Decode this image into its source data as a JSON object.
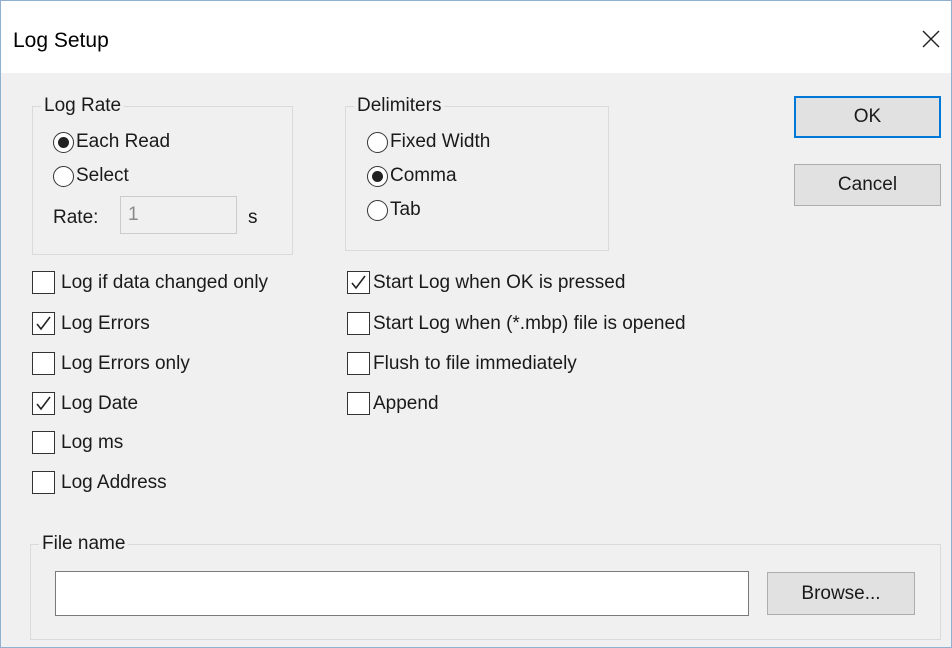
{
  "window": {
    "title": "Log Setup",
    "close_glyph": "✕"
  },
  "log_rate": {
    "label": "Log Rate",
    "options": [
      {
        "label": "Each Read",
        "selected": true
      },
      {
        "label": "Select",
        "selected": false
      }
    ],
    "rate_label": "Rate:",
    "rate_value": "1",
    "rate_unit": "s"
  },
  "delimiters": {
    "label": "Delimiters",
    "options": [
      {
        "label": "Fixed Width",
        "selected": false
      },
      {
        "label": "Comma",
        "selected": true
      },
      {
        "label": "Tab",
        "selected": false
      }
    ]
  },
  "buttons": {
    "ok": "OK",
    "cancel": "Cancel",
    "browse": "Browse..."
  },
  "left_checks": [
    {
      "label": "Log if data changed only",
      "checked": false
    },
    {
      "label": "Log Errors",
      "checked": true
    },
    {
      "label": "Log Errors only",
      "checked": false
    },
    {
      "label": "Log Date",
      "checked": true
    },
    {
      "label": "Log ms",
      "checked": false
    },
    {
      "label": "Log Address",
      "checked": false
    }
  ],
  "right_checks": [
    {
      "label": "Start Log when OK is pressed",
      "checked": true
    },
    {
      "label": "Start Log when (*.mbp) file is opened",
      "checked": false
    },
    {
      "label": "Flush to file immediately",
      "checked": false
    },
    {
      "label": "Append",
      "checked": false
    }
  ],
  "file": {
    "label": "File name",
    "value": ""
  },
  "colors": {
    "accent": "#0078d7",
    "dialog_bg": "#f0f0f0",
    "titlebar_bg": "#ffffff"
  }
}
